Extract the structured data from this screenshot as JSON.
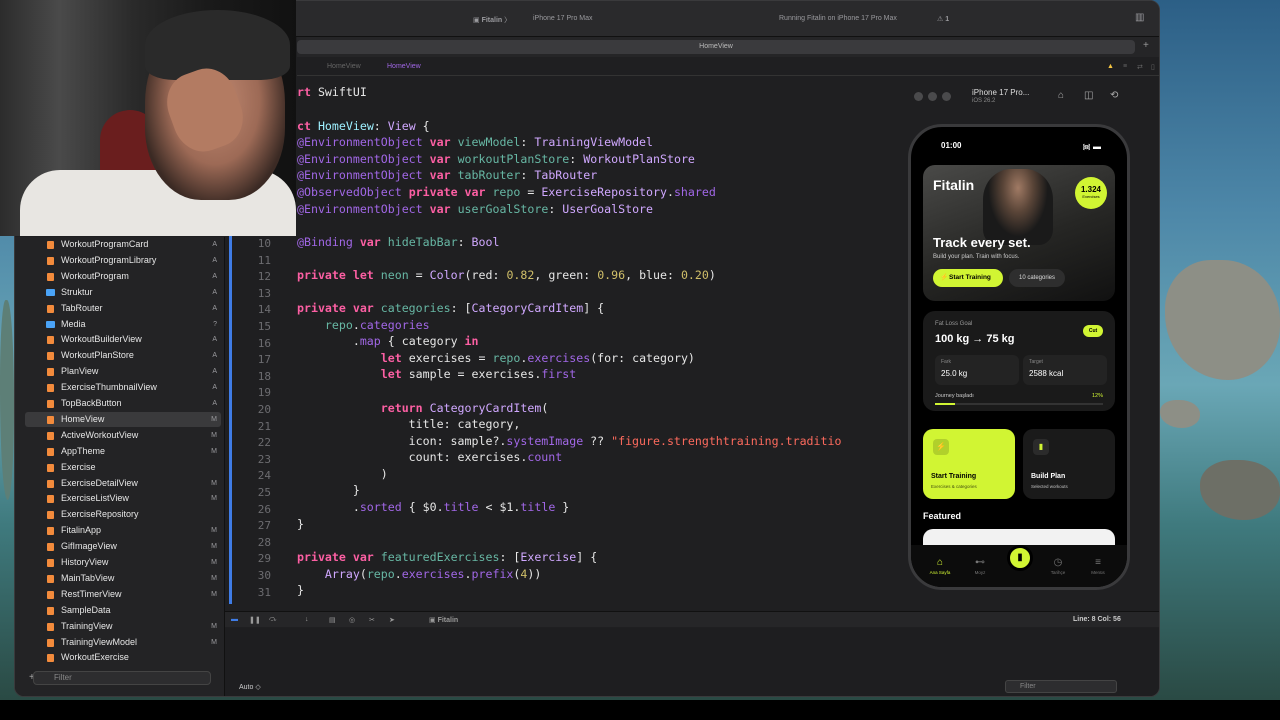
{
  "titlebar": {
    "scheme": "Fitalin",
    "device": "iPhone 17 Pro Max",
    "status": "Running Fitalin on iPhone 17 Pro Max",
    "warnings": "1"
  },
  "tab": {
    "label": "HomeView"
  },
  "jumpbar": {
    "path1": "HomeView",
    "path2": "HomeView"
  },
  "navigator": {
    "items": [
      {
        "label": "WorkoutProgramCard",
        "status": "A"
      },
      {
        "label": "WorkoutProgramLibrary",
        "status": "A"
      },
      {
        "label": "WorkoutProgram",
        "status": "A"
      },
      {
        "label": "Struktur",
        "status": "A"
      },
      {
        "label": "TabRouter",
        "status": "A"
      },
      {
        "label": "Media",
        "status": "?"
      },
      {
        "label": "WorkoutBuilderView",
        "status": "A"
      },
      {
        "label": "WorkoutPlanStore",
        "status": "A"
      },
      {
        "label": "PlanView",
        "status": "A"
      },
      {
        "label": "ExerciseThumbnailView",
        "status": "A"
      },
      {
        "label": "TopBackButton",
        "status": "A"
      },
      {
        "label": "HomeView",
        "status": "M"
      },
      {
        "label": "ActiveWorkoutView",
        "status": "M"
      },
      {
        "label": "AppTheme",
        "status": "M"
      },
      {
        "label": "Exercise",
        "status": ""
      },
      {
        "label": "ExerciseDetailView",
        "status": "M"
      },
      {
        "label": "ExerciseListView",
        "status": "M"
      },
      {
        "label": "ExerciseRepository",
        "status": ""
      },
      {
        "label": "FitalinApp",
        "status": "M"
      },
      {
        "label": "GifImageView",
        "status": "M"
      },
      {
        "label": "HistoryView",
        "status": "M"
      },
      {
        "label": "MainTabView",
        "status": "M"
      },
      {
        "label": "RestTimerView",
        "status": "M"
      },
      {
        "label": "SampleData",
        "status": ""
      },
      {
        "label": "TrainingView",
        "status": "M"
      },
      {
        "label": "TrainingViewModel",
        "status": "M"
      },
      {
        "label": "WorkoutExercise",
        "status": ""
      }
    ],
    "filter_placeholder": "Filter"
  },
  "editor": {
    "line_numbers": [
      "10",
      "11",
      "12",
      "13",
      "14",
      "15",
      "16",
      "17",
      "18",
      "19",
      "20",
      "21",
      "22",
      "23",
      "24",
      "25",
      "26",
      "27",
      "28",
      "29",
      "30",
      "31"
    ]
  },
  "debug": {
    "target": "Fitalin",
    "cursor": "Line: 8  Col: 56"
  },
  "console": {
    "auto_label": "Auto ◇",
    "filter_placeholder": "Filter"
  },
  "simulator": {
    "title": "iPhone 17 Pro...",
    "os": "iOS 26.2"
  },
  "app": {
    "time": "01:00",
    "brand": "Fitalin",
    "badge_count": "1.324",
    "badge_label": "Exercises",
    "hero_title": "Track every set.",
    "hero_subtitle": "Build your plan. Train with focus.",
    "start_training": "Start Training",
    "categories_chip": "10 categories",
    "goal_label": "Fat Loss Goal",
    "goal_value": "100 kg → 75 kg",
    "goal_tag": "Cut",
    "stat1_label": "Fark",
    "stat1_value": "25.0 kg",
    "stat2_label": "Target",
    "stat2_value": "2588 kcal",
    "journey_label": "Journey başladı",
    "journey_pct": "12%",
    "journey_progress": 0.12,
    "action_start_title": "Start Training",
    "action_start_sub": "Exercises & categories",
    "action_build_title": "Build Plan",
    "action_build_sub": "Selected workouts",
    "featured": "Featured",
    "tabs": [
      "Ana Sayfa",
      "Moyz",
      "",
      "Tarihçe",
      "Menüs"
    ]
  },
  "colors": {
    "neon": "#d1f533",
    "accent_blue": "#3f7ce6"
  }
}
